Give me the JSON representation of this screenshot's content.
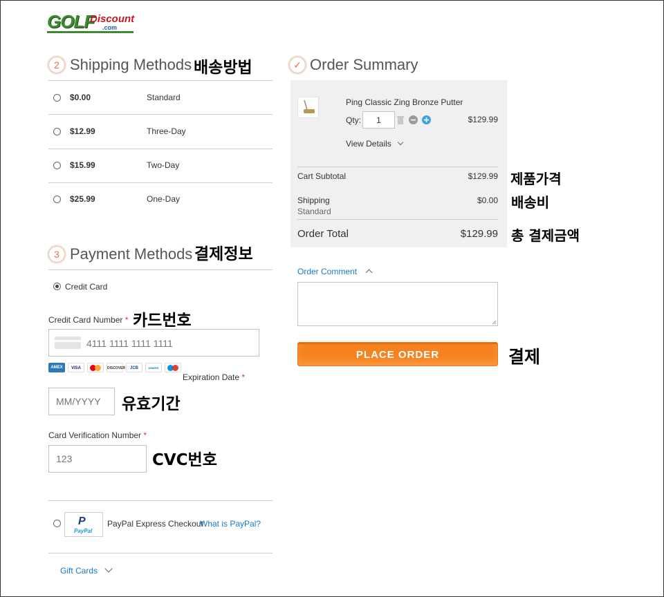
{
  "logo": {
    "golf": "GOLF",
    "discount": "Discount",
    "com": ".com"
  },
  "shipping": {
    "step": "2",
    "title": "Shipping Methods",
    "annotation": "배송방법",
    "rows": [
      {
        "price": "$0.00",
        "method": "Standard"
      },
      {
        "price": "$12.99",
        "method": "Three-Day"
      },
      {
        "price": "$15.99",
        "method": "Two-Day"
      },
      {
        "price": "$25.99",
        "method": "One-Day"
      }
    ]
  },
  "payment": {
    "step": "3",
    "title": "Payment Methods",
    "annotation": "결제정보",
    "credit_card_label": "Credit Card",
    "card_number_label": "Credit Card Number",
    "card_number_annotation": "카드번호",
    "card_number_placeholder": "4111 1111 1111 1111",
    "card_brands": [
      "AMEX",
      "VISA",
      "MC",
      "DISCOVER",
      "JCB",
      "DINERS",
      "MAESTRO"
    ],
    "expiration_label": "Expiration Date",
    "expiration_placeholder": "MM/YYYY",
    "expiration_annotation": "유효기간",
    "cvv_label": "Card Verification Number",
    "cvv_placeholder": "123",
    "cvv_annotation": "CVC번호",
    "required_mark": "*",
    "paypal_logo": "PayPal",
    "paypal_label": "PayPal Express Checkout",
    "paypal_link": "What is PayPal?",
    "gift_cards": "Gift Cards"
  },
  "summary": {
    "title": "Order Summary",
    "check": "✓",
    "item_name": "Ping Classic Zing Bronze Putter",
    "qty_label": "Qty:",
    "qty_value": "1",
    "item_price": "$129.99",
    "view_details": "View Details",
    "subtotal_label": "Cart Subtotal",
    "subtotal_value": "$129.99",
    "subtotal_annotation": "제품가격",
    "shipping_label": "Shipping",
    "shipping_method": "Standard",
    "shipping_value": "$0.00",
    "shipping_annotation": "배송비",
    "total_label": "Order Total",
    "total_value": "$129.99",
    "total_annotation": "총 결제금액",
    "comment_label": "Order Comment",
    "place_order": "PLACE ORDER",
    "place_order_annotation": "결제"
  }
}
